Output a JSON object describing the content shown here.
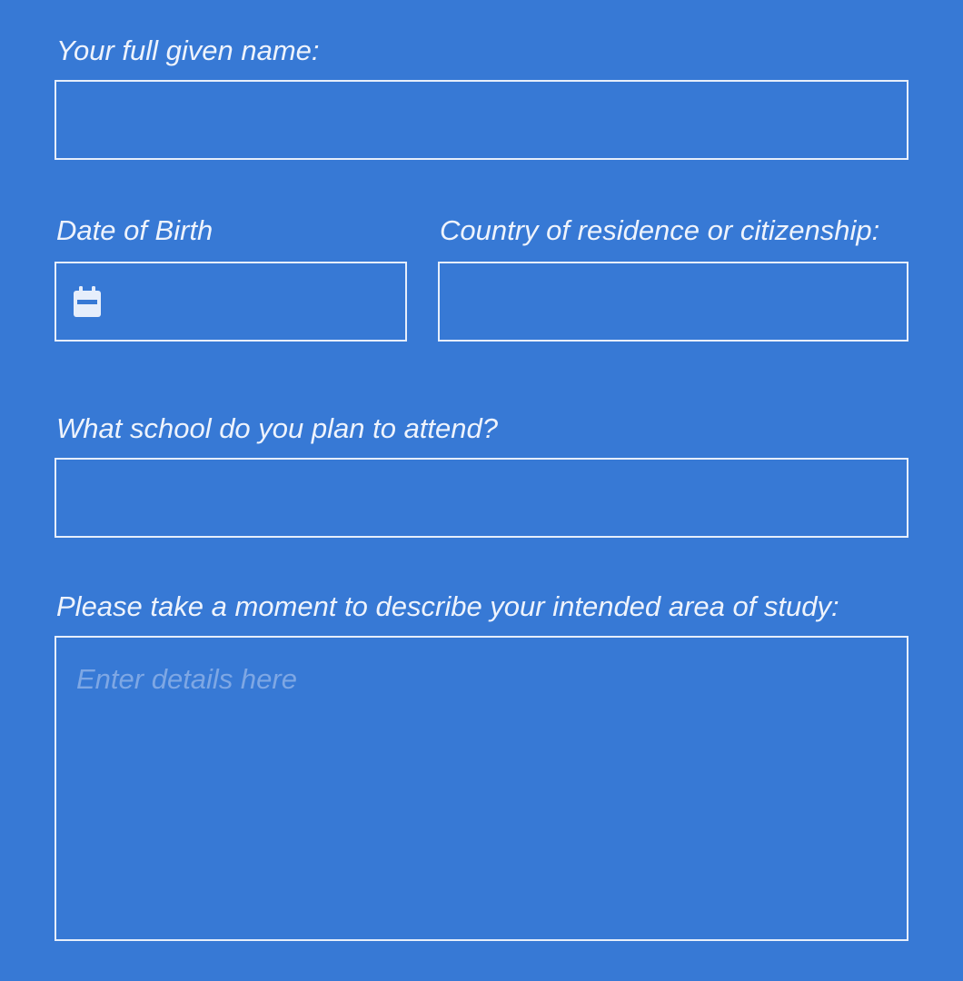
{
  "form": {
    "full_name": {
      "label": "Your full given name:",
      "value": ""
    },
    "dob": {
      "label": "Date of Birth",
      "value": "",
      "icon": "calendar-icon"
    },
    "country": {
      "label": "Country of residence or citizenship:",
      "value": ""
    },
    "school": {
      "label": "What school do you plan to attend?",
      "value": ""
    },
    "study": {
      "label": "Please take a moment to describe your intended area of study:",
      "placeholder": "Enter details here",
      "value": ""
    }
  },
  "colors": {
    "background": "#3779d5",
    "text": "#eef3fc",
    "border": "#e6eefb",
    "placeholder": "#7ea7e4"
  }
}
